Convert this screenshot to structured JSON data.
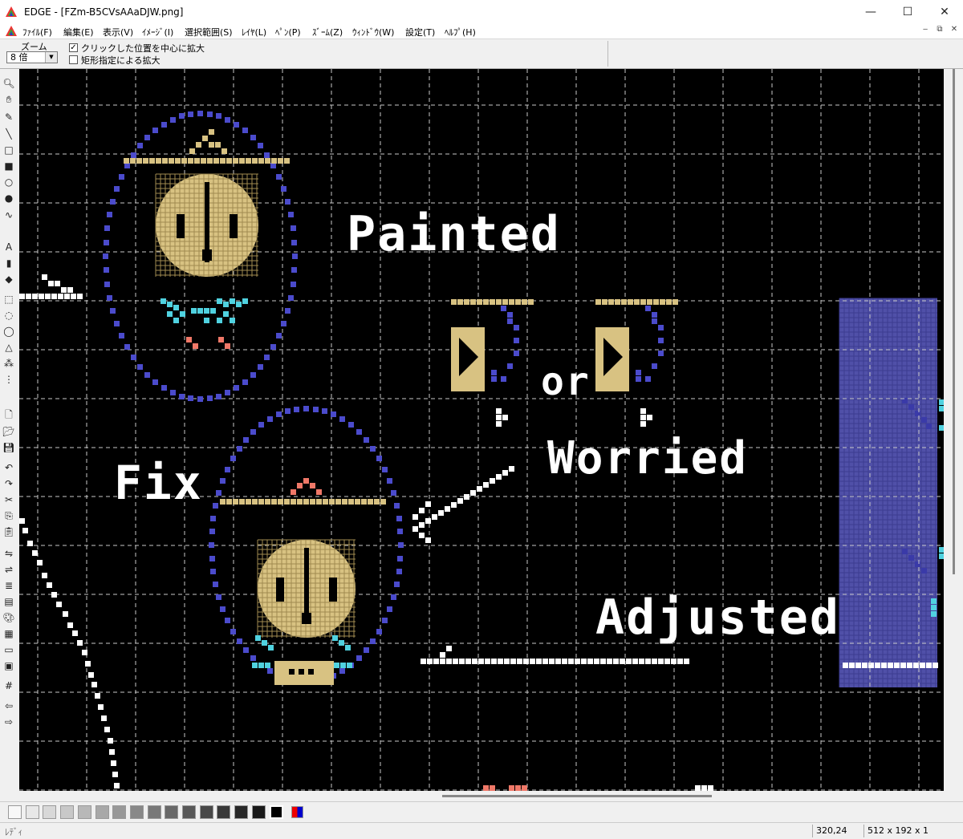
{
  "window": {
    "title": "EDGE - [FZm-B5CVsAAaDJW.png]",
    "min_icon": "minimize-icon",
    "max_icon": "maximize-icon",
    "close_icon": "close-icon"
  },
  "menu": [
    {
      "label": "ﾌｧｲﾙ(F)"
    },
    {
      "label": "編集(E)"
    },
    {
      "label": "表示(V)"
    },
    {
      "label": "ｲﾒｰｼﾞ(I)"
    },
    {
      "label": "選択範囲(S)"
    },
    {
      "label": "ﾚｲﾔ(L)"
    },
    {
      "label": "ﾍﾟﾝ(P)"
    },
    {
      "label": "ｽﾞｰﾑ(Z)"
    },
    {
      "label": "ｳｨﾝﾄﾞｳ(W)"
    },
    {
      "label": "設定(T)"
    },
    {
      "label": "ﾍﾙﾌﾟ(H)"
    }
  ],
  "toolbar": {
    "zoom_label": "ズーム",
    "zoom_value": "8 倍",
    "option1": {
      "label": "クリックした位置を中心に拡大",
      "checked": true
    },
    "option2": {
      "label": "矩形指定による拡大",
      "checked": false
    }
  },
  "tools": [
    "zoom-tool-icon",
    "hand-tool-icon",
    "pencil-tool-icon",
    "line-tool-icon",
    "rectangle-tool-icon",
    "filled-rectangle-tool-icon",
    "ellipse-tool-icon",
    "filled-ellipse-tool-icon",
    "curve-tool-icon",
    "text-tool-icon",
    "fill-bucket-tool-icon",
    "color-picker-tool-icon",
    "rect-select-icon",
    "ellipse-select-icon",
    "lasso-select-icon",
    "polygon-select-icon",
    "magic-wand-icon",
    "dotted-select-icon",
    "new-file-icon",
    "open-file-icon",
    "save-file-icon",
    "undo-icon",
    "redo-icon",
    "cut-icon",
    "copy-icon",
    "paste-icon",
    "flip-icon",
    "mirror-icon",
    "layer-icon",
    "stamp-icon",
    "palette-icon",
    "film-icon",
    "screen-icon",
    "screen-capture-icon",
    "grid-icon",
    "arrow-left-icon",
    "arrow-right-icon"
  ],
  "canvas": {
    "labels": {
      "painted": "Painted",
      "or": "or",
      "worried": "Worried",
      "fix": "Fix",
      "adjusted": "Adjusted"
    },
    "colors": {
      "background": "#000000",
      "gridline": "#c8c8c8",
      "outline_blue": "#4b4bcc",
      "skin": "#d8c282",
      "cyan": "#50d2e0",
      "salmon": "#f07868",
      "white": "#ffffff",
      "panel_blue": "#5050a8"
    }
  },
  "palette": [
    {
      "color": "#f8f8f8"
    },
    {
      "color": "#e8e8e8"
    },
    {
      "color": "#d8d8d8"
    },
    {
      "color": "#c8c8c8"
    },
    {
      "color": "#b8b8b8"
    },
    {
      "color": "#a8a8a8"
    },
    {
      "color": "#989898"
    },
    {
      "color": "#888888"
    },
    {
      "color": "#787878"
    },
    {
      "color": "#686868"
    },
    {
      "color": "#585858"
    },
    {
      "color": "#484848"
    },
    {
      "color": "#383838"
    },
    {
      "color": "#282828"
    },
    {
      "color": "#181818"
    },
    {
      "color": "#000000"
    }
  ],
  "status": {
    "message": "ﾚﾃﾞｨ",
    "coords": "320,24",
    "size": "512 x 192 x 1"
  }
}
